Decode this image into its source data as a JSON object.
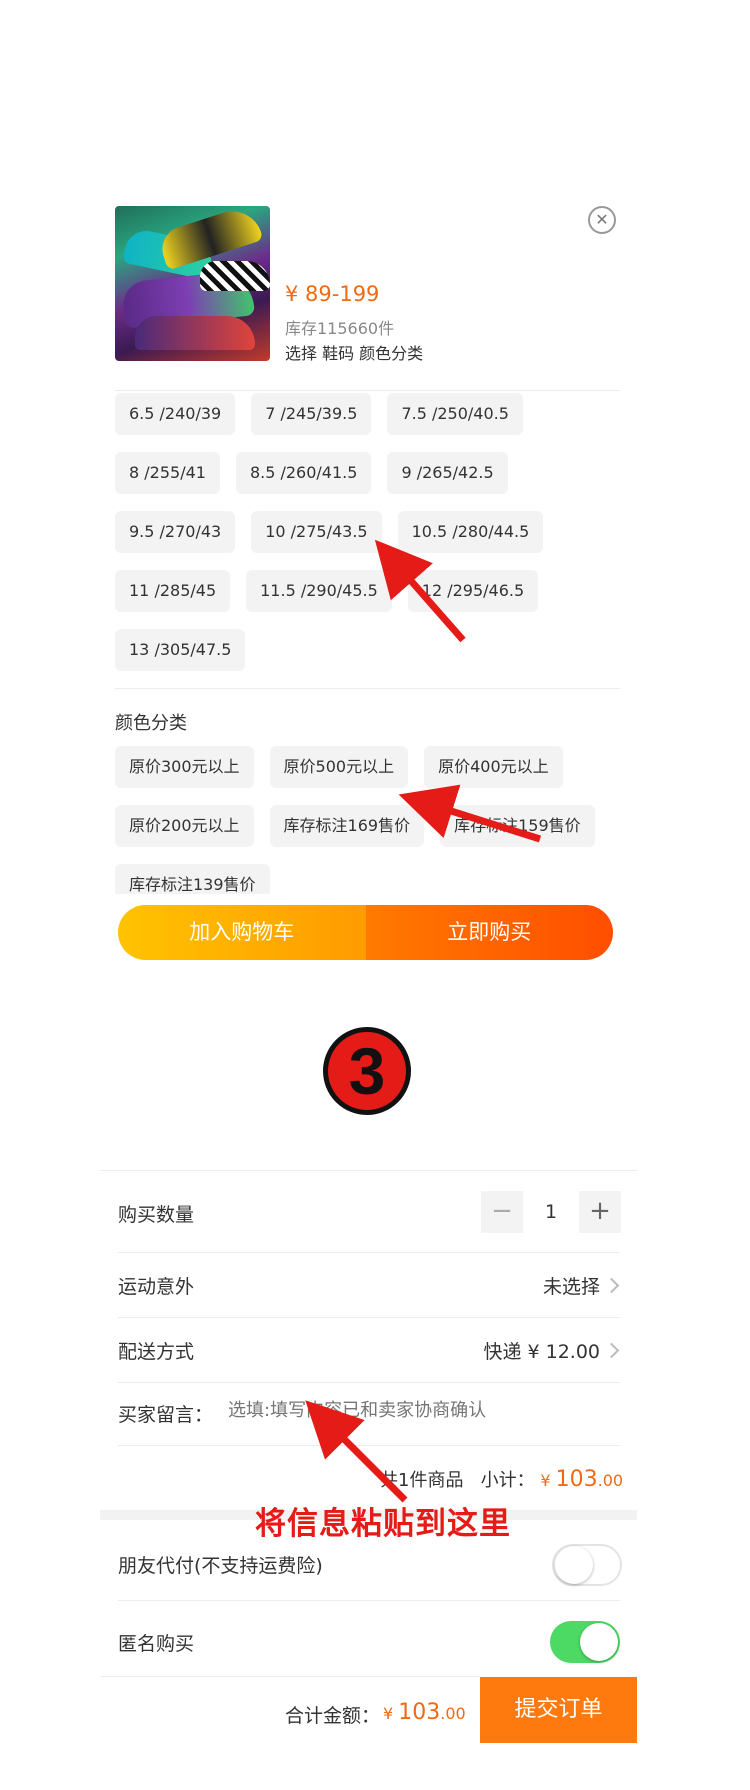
{
  "product": {
    "price": "¥ 89-199",
    "stock": "库存115660件",
    "select_hint": "选择  鞋码 颜色分类",
    "close_icon": "close-icon"
  },
  "sizes": [
    "6.5 /240/39",
    "7 /245/39.5",
    "7.5 /250/40.5",
    "8 /255/41",
    "8.5 /260/41.5",
    "9 /265/42.5",
    "9.5 /270/43",
    "10 /275/43.5",
    "10.5 /280/44.5",
    "11 /285/45",
    "11.5 /290/45.5",
    "12 /295/46.5",
    "13 /305/47.5"
  ],
  "color_section": {
    "label": "颜色分类",
    "options": [
      "原价300元以上",
      "原价500元以上",
      "原价400元以上",
      "原价200元以上",
      "库存标注169售价",
      "库存标注159售价",
      "库存标注139售价"
    ]
  },
  "buy_bar": {
    "cart_label": "加入购物车",
    "buy_label": "立即购买"
  },
  "step_badge": "3",
  "order": {
    "quantity_label": "购买数量",
    "quantity_minus": "−",
    "quantity_value": "1",
    "quantity_plus": "+",
    "insurance_label": "运动意外",
    "insurance_value": "未选择",
    "shipping_label": "配送方式",
    "shipping_value": "快递 ¥ 12.00",
    "memo_label": "买家留言：",
    "memo_placeholder": "选填:填写内容已和卖家协商确认",
    "count_text": "共1件商品",
    "subtotal_label": "小计：",
    "subtotal_currency": "¥",
    "subtotal_int": "103",
    "subtotal_dec": ".00",
    "friend_pay_label": "朋友代付(不支持运费险)",
    "friend_pay_on": false,
    "anonymous_label": "匿名购买",
    "anonymous_on": true
  },
  "footer": {
    "total_label": "合计金额：",
    "total_currency": "¥",
    "total_int": "103",
    "total_dec": ".00",
    "submit_label": "提交订单"
  },
  "annotation": {
    "text": "将信息粘贴到这里"
  },
  "colors": {
    "accent": "#ef6a13",
    "submit": "#ff7a0e",
    "toggle_on": "#4cd964",
    "annotation": "#e41b17"
  }
}
